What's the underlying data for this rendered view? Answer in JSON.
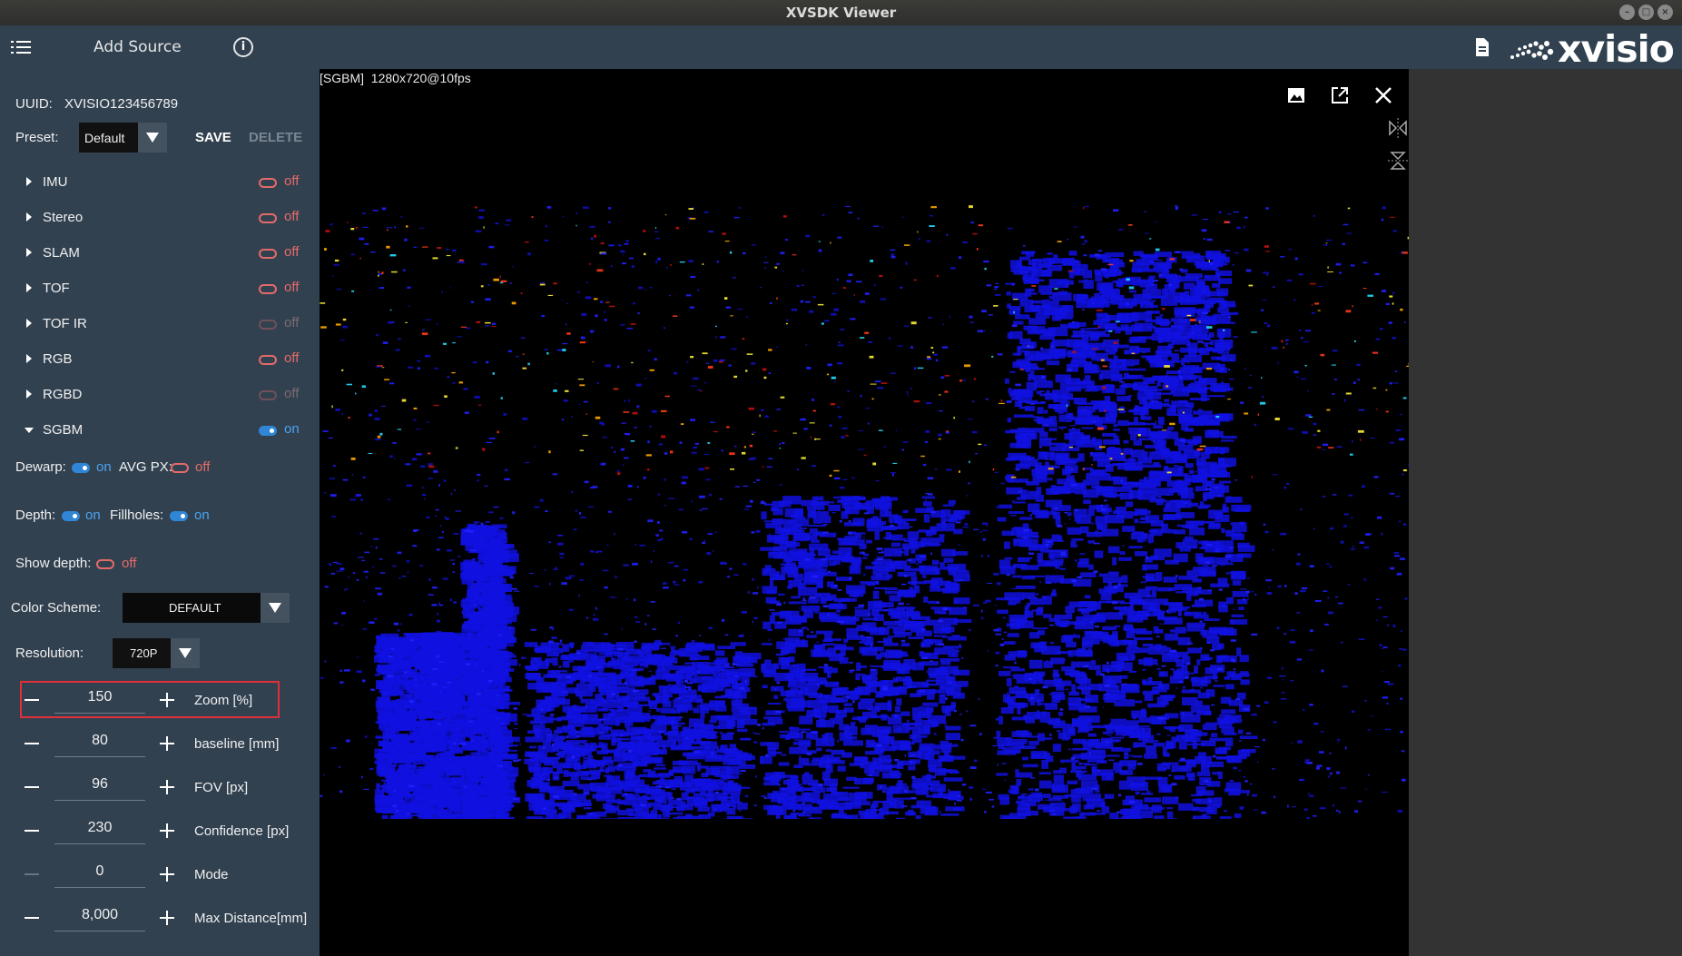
{
  "window": {
    "title": "XVSDK Viewer"
  },
  "header": {
    "add_source": "Add Source",
    "logo": "xvisio"
  },
  "sidebar": {
    "uuid_label": "UUID:",
    "uuid_value": "XVISIO123456789",
    "preset_label": "Preset:",
    "preset_value": "Default",
    "save": "SAVE",
    "delete": "DELETE",
    "sensors": [
      {
        "label": "IMU",
        "state": "off"
      },
      {
        "label": "Stereo",
        "state": "off"
      },
      {
        "label": "SLAM",
        "state": "off"
      },
      {
        "label": "TOF",
        "state": "off"
      },
      {
        "label": "TOF IR",
        "state": "off"
      },
      {
        "label": "RGB",
        "state": "off"
      },
      {
        "label": "RGBD",
        "state": "off"
      },
      {
        "label": "SGBM",
        "state": "on"
      }
    ],
    "dewarp_label": "Dewarp:",
    "dewarp_state": "on",
    "avgpx_label": "AVG PX:",
    "avgpx_state": "off",
    "depth_label": "Depth:",
    "depth_state": "on",
    "fillholes_label": "Fillholes:",
    "fillholes_state": "on",
    "showdepth_label": "Show depth:",
    "showdepth_state": "off",
    "colorscheme_label": "Color Scheme:",
    "colorscheme_value": "DEFAULT",
    "resolution_label": "Resolution:",
    "resolution_value": "720P",
    "params": [
      {
        "value": "150",
        "label": "Zoom [%]"
      },
      {
        "value": "80",
        "label": "baseline [mm]"
      },
      {
        "value": "96",
        "label": "FOV [px]"
      },
      {
        "value": "230",
        "label": "Confidence [px]"
      },
      {
        "value": "0",
        "label": "Mode"
      },
      {
        "value": "8,000",
        "label": "Max Distance[mm]"
      }
    ]
  },
  "view": {
    "stream_tag": "[SGBM]",
    "stream_info": "1280x720@10fps"
  },
  "colors": {
    "panel": "#324150",
    "header": "#314150",
    "toggle_on": "#2f86d6",
    "toggle_off": "#e46a6a",
    "depth_blue": "#1010e0"
  }
}
